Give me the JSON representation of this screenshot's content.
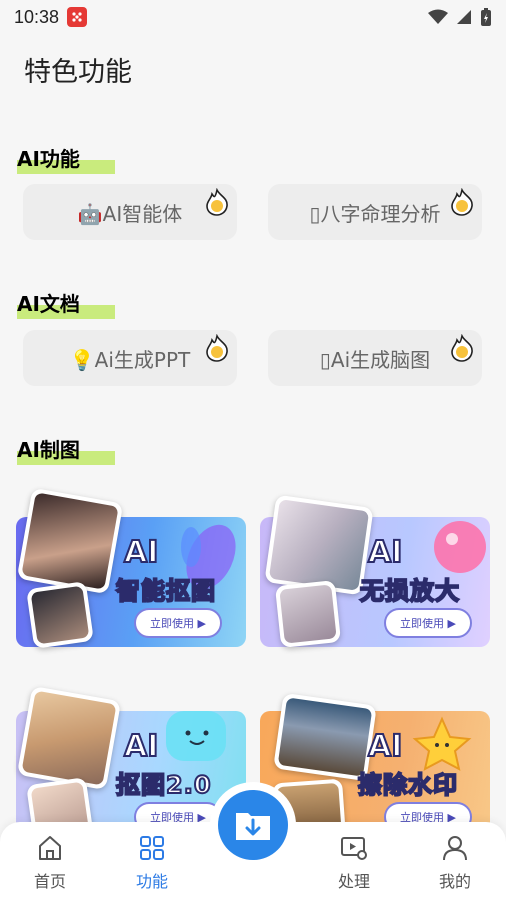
{
  "status": {
    "time": "10:38"
  },
  "page": {
    "title": "特色功能"
  },
  "sections": [
    {
      "title": "AI功能",
      "items": [
        {
          "label": "🤖AI智能体"
        },
        {
          "label": "▯八字命理分析"
        }
      ]
    },
    {
      "title": "AI文档",
      "items": [
        {
          "label": "💡Ai生成PPT"
        },
        {
          "label": "▯Ai生成脑图"
        }
      ]
    },
    {
      "title": "AI制图"
    }
  ],
  "cards": [
    {
      "ai": "AI",
      "name": "智能抠图",
      "cta": "立即使用 ▶"
    },
    {
      "ai": "AI",
      "name": "无损放大",
      "cta": "立即使用 ▶"
    },
    {
      "ai": "AI",
      "name": "抠图2.0",
      "cta": "立即使用 ▶"
    },
    {
      "ai": "AI",
      "name": "擦除水印",
      "cta": "立即使用 ▶"
    }
  ],
  "nav": {
    "items": [
      {
        "label": "首页",
        "icon": "home-icon"
      },
      {
        "label": "功能",
        "icon": "grid-icon"
      },
      {
        "label": "处理",
        "icon": "video-settings-icon"
      },
      {
        "label": "我的",
        "icon": "user-icon"
      }
    ],
    "active_color": "#2d7be5",
    "fab_color": "#2a86e8",
    "fab_icon": "download-folder-icon"
  }
}
